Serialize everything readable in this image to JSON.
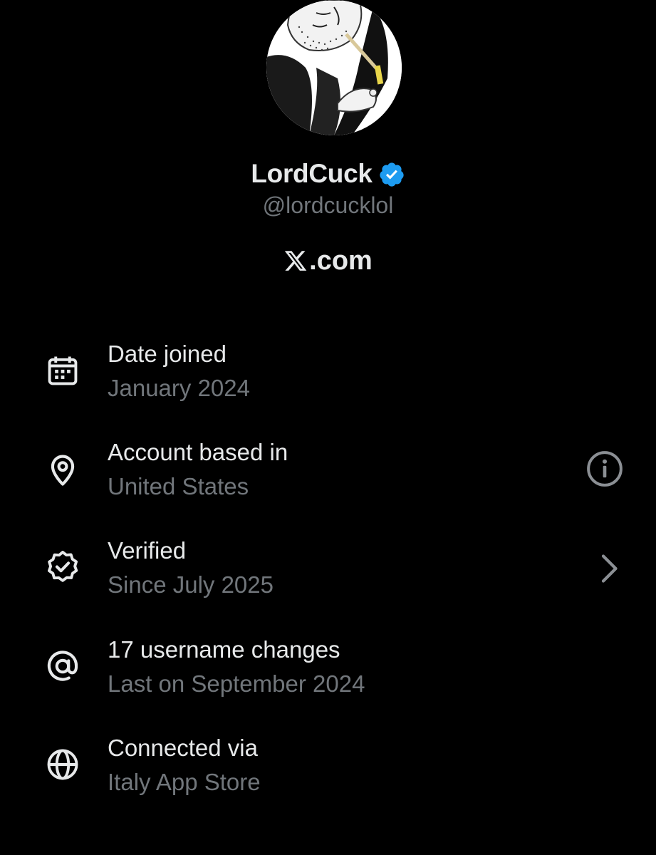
{
  "profile": {
    "display_name": "LordCuck",
    "handle": "@lordcucklol",
    "site": ".com",
    "avatar_icon": "avatar-illustration",
    "verified_icon": "verified-badge-icon",
    "verified_color": "#1d9bf0"
  },
  "details": [
    {
      "title": "Date joined",
      "subtitle": "January 2024",
      "icon": "calendar-icon"
    },
    {
      "title": "Account based in",
      "subtitle": "United States",
      "icon": "location-pin-icon",
      "trailing_icon": "info-icon"
    },
    {
      "title": "Verified",
      "subtitle": "Since July 2025",
      "icon": "verified-outline-icon",
      "trailing_icon": "chevron-right-icon"
    },
    {
      "title": "17 username changes",
      "subtitle": "Last on September 2024",
      "icon": "at-sign-icon"
    },
    {
      "title": "Connected via",
      "subtitle": "Italy App Store",
      "icon": "globe-icon"
    }
  ],
  "colors": {
    "background": "#000000",
    "primary_text": "#e7e9ea",
    "secondary_text": "#71767b",
    "icon": "#e7e9ea",
    "trailing_icon": "#8b8f94"
  }
}
